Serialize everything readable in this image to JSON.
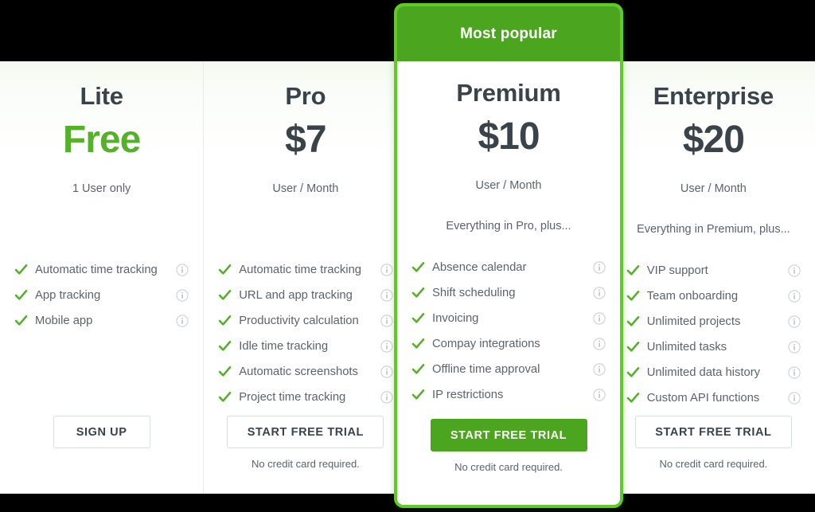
{
  "theme": {
    "accent_green": "#4ca51e",
    "bright_green": "#5ecb26",
    "free_green": "#55b12a",
    "text_dark": "#3a4349",
    "text_muted": "#5b646b"
  },
  "icons": {
    "check": "check-icon",
    "info": "info-icon"
  },
  "featured_badge": "Most popular",
  "plans": [
    {
      "name": "Lite",
      "price": "Free",
      "price_is_free": true,
      "unit": "1 User only",
      "plus_note": "",
      "features": [
        "Automatic time tracking",
        "App tracking",
        "Mobile app"
      ],
      "cta_label": "SIGN UP",
      "cta_note": "",
      "cta_style": "outline"
    },
    {
      "name": "Pro",
      "price": "$7",
      "price_is_free": false,
      "unit": "User / Month",
      "plus_note": "",
      "features": [
        "Automatic time tracking",
        "URL and app tracking",
        "Productivity calculation",
        "Idle time tracking",
        "Automatic screenshots",
        "Project time tracking"
      ],
      "cta_label": "START FREE TRIAL",
      "cta_note": "No credit card required.",
      "cta_style": "outline"
    },
    {
      "name": "Premium",
      "price": "$10",
      "price_is_free": false,
      "unit": "User / Month",
      "plus_note": "Everything in Pro, plus...",
      "features": [
        "Absence calendar",
        "Shift scheduling",
        "Invoicing",
        "Compay integrations",
        "Offline time approval",
        "IP restrictions"
      ],
      "cta_label": "START FREE TRIAL",
      "cta_note": "No credit card required.",
      "cta_style": "primary",
      "featured": true
    },
    {
      "name": "Enterprise",
      "price": "$20",
      "price_is_free": false,
      "unit": "User / Month",
      "plus_note": "Everything in Premium, plus...",
      "features": [
        "VIP support",
        "Team onboarding",
        "Unlimited projects",
        "Unlimited tasks",
        "Unlimited data history",
        "Custom API functions"
      ],
      "cta_label": "START FREE TRIAL",
      "cta_note": "No credit card required.",
      "cta_style": "outline"
    }
  ]
}
